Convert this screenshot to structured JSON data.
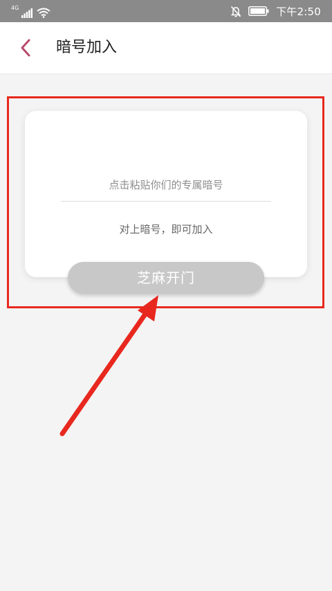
{
  "status_bar": {
    "network_type": "4G",
    "time": "下午2:50",
    "icons": [
      "signal-icon",
      "wifi-icon",
      "mute-icon",
      "battery-icon"
    ]
  },
  "header": {
    "back_icon": "chevron-left-icon",
    "title": "暗号加入"
  },
  "card": {
    "input_placeholder": "点击粘贴你们的专属暗号",
    "input_value": "",
    "hint": "对上暗号，即可加入"
  },
  "button": {
    "label": "芝麻开门"
  },
  "colors": {
    "accent": "#b84a6a",
    "annotation_red": "#e8281e",
    "button_disabled": "#c8c8c8",
    "status_bar_bg": "#8a8a8a"
  }
}
